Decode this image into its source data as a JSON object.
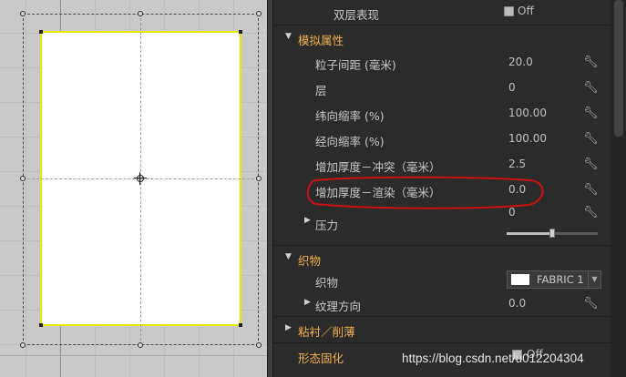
{
  "panel": {
    "rows": [
      {
        "label": "双层表现",
        "value": "Off",
        "kind": "checkbox"
      },
      {
        "label": "模拟属性",
        "kind": "section",
        "expanded": true
      },
      {
        "label": "粒子间距 (毫米)",
        "value": "20.0"
      },
      {
        "label": "层",
        "value": "0"
      },
      {
        "label": "纬向缩率 (%)",
        "value": "100.00"
      },
      {
        "label": "经向缩率 (%)",
        "value": "100.00"
      },
      {
        "label": "增加厚度－冲突（毫米）",
        "value": "2.5"
      },
      {
        "label": "增加厚度－渲染（毫米）",
        "value": "0.0"
      },
      {
        "label": "压力",
        "value": "0",
        "kind": "slider",
        "level_fraction": 0.5
      },
      {
        "label": "织物",
        "kind": "section",
        "expanded": true
      },
      {
        "label": "织物",
        "value": "FABRIC 1",
        "kind": "swatch",
        "swatch_color": "#ffffff"
      },
      {
        "label": "纹理方向",
        "value": "0.0",
        "expandable": true
      },
      {
        "label": "粘衬／削薄",
        "kind": "section",
        "expanded": false
      },
      {
        "label": "形态固化",
        "value": "Off",
        "kind": "checkbox"
      }
    ]
  },
  "icons": {
    "row_action": "wrench-icon",
    "expand": "triangle-icon"
  },
  "colors": {
    "section_header": "#f0b050",
    "annotation": "#cc1111",
    "pattern_border": "#e8e800",
    "viewport_bg": "#c9c9c9",
    "panel_bg": "#2b2b2b"
  },
  "watermark": "https://blog.csdn.net/u012204304"
}
